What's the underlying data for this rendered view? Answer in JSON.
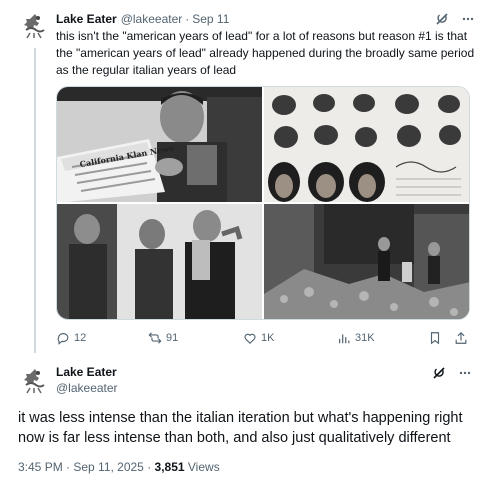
{
  "tweet1": {
    "author_name": "Lake Eater",
    "author_handle": "@lakeeater",
    "separator": "·",
    "date": "Sep 11",
    "text": "this isn't the \"american years of lead\" for a lot of reasons but reason #1 is that the \"american years of lead\" already happened during the broadly same period as the regular italian years of lead",
    "media": {
      "newspaper_masthead": "California Klan News"
    },
    "actions": {
      "replies": "12",
      "reposts": "91",
      "likes": "1K",
      "views": "31K"
    }
  },
  "tweet2": {
    "author_name": "Lake Eater",
    "author_handle": "@lakeeater",
    "text": "it was less intense than the italian iteration but what's happening right now is far less intense than both, and also just qualitatively different",
    "timestamp": "3:45 PM · Sep 11, 2025 · ",
    "views_count": "3,851",
    "views_label": " Views"
  },
  "colors": {
    "text_primary": "#0f1419",
    "text_secondary": "#536471",
    "border": "#cfd9de"
  },
  "icons": [
    "grok-icon",
    "more-icon",
    "reply-icon",
    "repost-icon",
    "like-icon",
    "views-icon",
    "bookmark-icon",
    "share-icon"
  ]
}
